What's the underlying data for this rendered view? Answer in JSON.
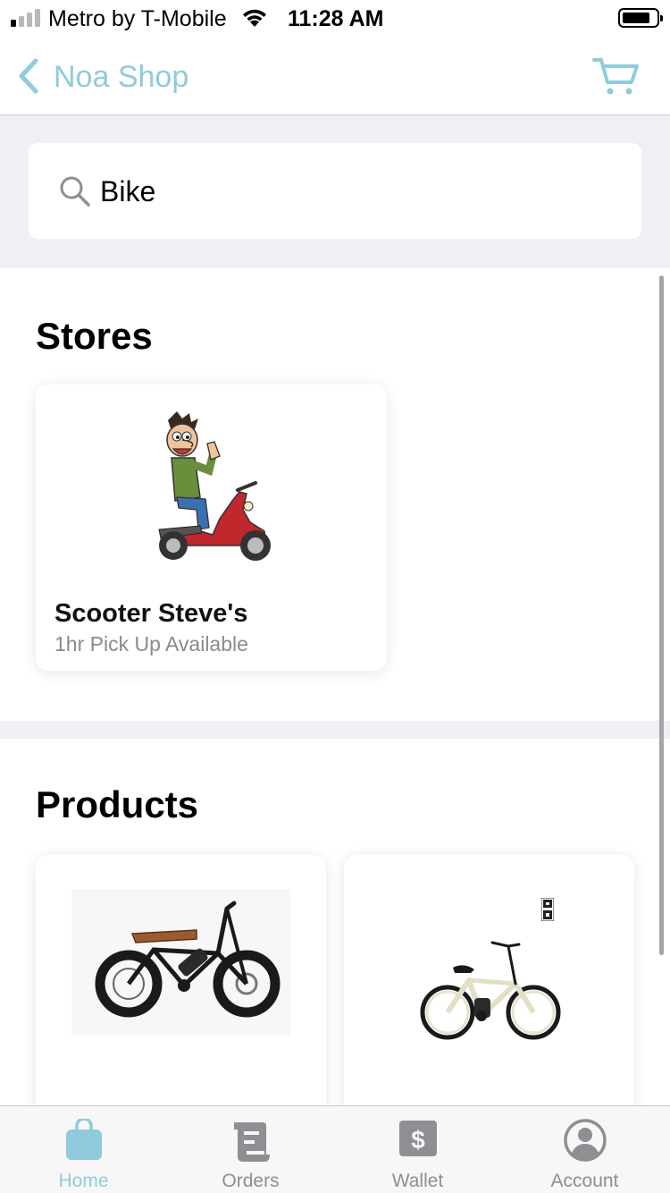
{
  "status_bar": {
    "carrier": "Metro by T-Mobile",
    "time": "11:28 AM",
    "signal_bars_filled": 1,
    "signal_bars_total": 4,
    "battery_level": 0.75
  },
  "nav": {
    "back_icon": "chevron-left-icon",
    "title": "Noa Shop",
    "cart_icon": "cart-icon",
    "accent_color": "#8fcbdc"
  },
  "search": {
    "icon": "search-icon",
    "value": "Bike"
  },
  "stores": {
    "title": "Stores",
    "items": [
      {
        "name": "Scooter Steve's",
        "subtitle": "1hr Pick Up Available",
        "image": "scooter-rider-image"
      }
    ]
  },
  "products": {
    "title": "Products",
    "items": [
      {
        "image": "fat-tire-ebike-image"
      },
      {
        "image": "cruiser-ebike-image"
      }
    ]
  },
  "tab_bar": {
    "active_color": "#8fcbdc",
    "inactive_color": "#8e8e93",
    "tabs": [
      {
        "label": "Home",
        "icon": "shopping-bag-icon",
        "active": true
      },
      {
        "label": "Orders",
        "icon": "receipt-icon",
        "active": false
      },
      {
        "label": "Wallet",
        "icon": "dollar-icon",
        "active": false
      },
      {
        "label": "Account",
        "icon": "user-circle-icon",
        "active": false
      }
    ]
  }
}
